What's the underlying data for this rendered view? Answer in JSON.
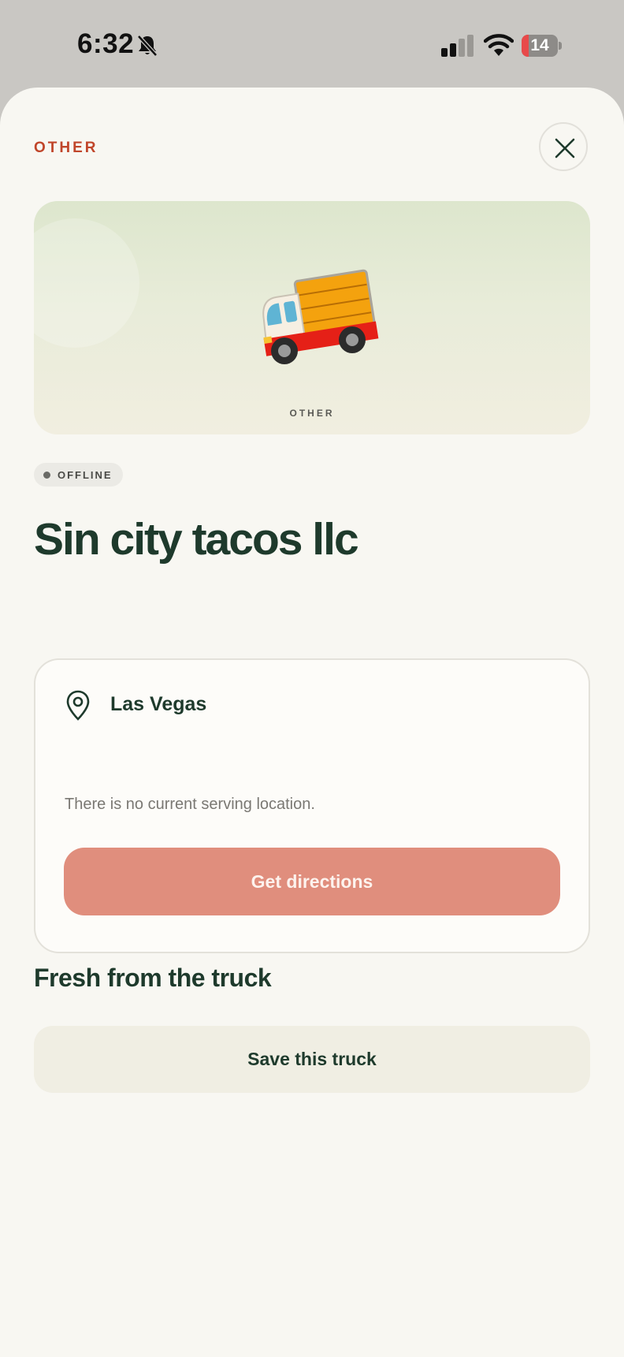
{
  "status_bar": {
    "time": "6:32",
    "battery_level": "14",
    "icons": [
      "bell-slash-icon",
      "cellular-signal-icon",
      "wifi-icon",
      "battery-icon"
    ]
  },
  "header": {
    "category": "OTHER",
    "close_icon": "close-icon"
  },
  "hero": {
    "emoji": "🚚",
    "label": "OTHER"
  },
  "status": {
    "label": "OFFLINE"
  },
  "truck": {
    "name": "Sin city tacos llc"
  },
  "location": {
    "city": "Las Vegas",
    "icon": "map-pin-icon",
    "note": "There is no current serving location.",
    "directions_label": "Get directions"
  },
  "menu": {
    "title": "Fresh from the truck"
  },
  "actions": {
    "save_label": "Save this truck"
  },
  "colors": {
    "accent": "#c0452a",
    "brand_dark": "#1e3a2c",
    "directions_button": "#e08e7d",
    "sheet_background": "#f8f7f2"
  }
}
